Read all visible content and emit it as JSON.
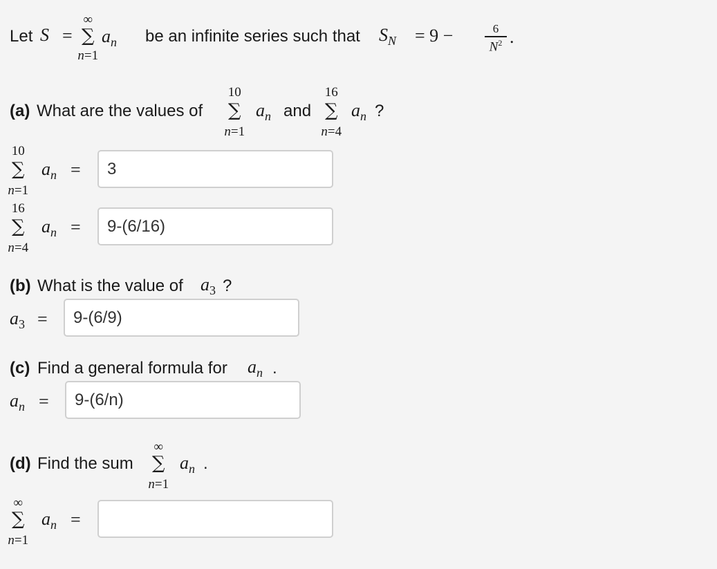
{
  "intro": {
    "prefix": "Let",
    "S": "S",
    "eq": "=",
    "sum_upper": "∞",
    "sum_lower_var": "n",
    "sum_lower_val": "=1",
    "term": "a",
    "term_sub": "n",
    "middle": "be an infinite series such that",
    "SN": "S",
    "SN_sub": "N",
    "eq2": "= 9 −",
    "frac_num": "6",
    "frac_den": "N",
    "frac_den_exp": "2",
    "period": "."
  },
  "part_a": {
    "label": "(a)",
    "question": "What are the values of",
    "sum1_upper": "10",
    "sum1_lower": "=1",
    "and_text": "and",
    "sum2_upper": "16",
    "sum2_lower": "=4",
    "qmark": "?",
    "row1": {
      "upper": "10",
      "lower": "=1",
      "value": "3"
    },
    "row2": {
      "upper": "16",
      "lower": "=4",
      "value": "9-(6/16)"
    }
  },
  "part_b": {
    "label": "(b)",
    "question": "What is the value of",
    "term": "a",
    "term_sub": "3",
    "qmark": "?",
    "value": "9-(6/9)"
  },
  "part_c": {
    "label": "(c)",
    "question": "Find a general formula for",
    "term": "a",
    "term_sub": "n",
    "period": ".",
    "value": "9-(6/n)"
  },
  "part_d": {
    "label": "(d)",
    "question": "Find the sum",
    "sum_upper": "∞",
    "sum_lower": "=1",
    "period": ".",
    "value": ""
  },
  "common": {
    "sigma": "∑",
    "n": "n",
    "a": "a",
    "eq": "="
  }
}
